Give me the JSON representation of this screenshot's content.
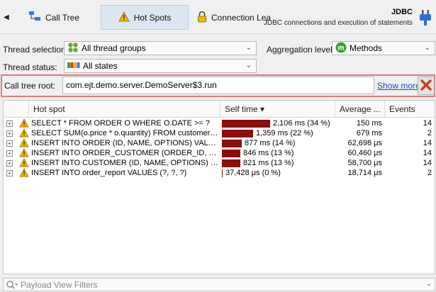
{
  "tabs": {
    "call_tree": "Call Tree",
    "hot_spots": "Hot Spots",
    "connection": "Connection Lea"
  },
  "header": {
    "title": "JDBC",
    "subtitle": "JDBC connections and execution of statements"
  },
  "form": {
    "thread_selection_label": "Thread selection:",
    "thread_selection_value": "All thread groups",
    "aggregation_label": "Aggregation level:",
    "aggregation_value": "Methods",
    "thread_status_label": "Thread status:",
    "thread_status_value": "All states",
    "call_tree_root_label": "Call tree root:",
    "call_tree_root_value": "com.ejt.demo.server.DemoServer$3.run",
    "show_more": "Show more"
  },
  "table": {
    "columns": [
      "Hot spot",
      "Self time ▾",
      "Average ...",
      "Events"
    ],
    "rows": [
      {
        "hotspot": "SELECT * FROM ORDER O WHERE O.DATE >= ?",
        "self": "2,106 ms (34 %)",
        "fraction": 0.34,
        "avg": "150 ms",
        "events": "14"
      },
      {
        "hotspot": "SELECT SUM(o.price * o.quantity) FROM customers ...",
        "self": "1,359 ms (22 %)",
        "fraction": 0.22,
        "avg": "679 ms",
        "events": "2"
      },
      {
        "hotspot": "INSERT INTO ORDER (ID, NAME, OPTIONS) VALUES...",
        "self": "877 ms (14 %)",
        "fraction": 0.14,
        "avg": "62,698 μs",
        "events": "14"
      },
      {
        "hotspot": "INSERT INTO ORDER_CUSTOMER (ORDER_ID, CUS...",
        "self": "846 ms (13 %)",
        "fraction": 0.13,
        "avg": "60,460 μs",
        "events": "14"
      },
      {
        "hotspot": "INSERT INTO CUSTOMER (ID, NAME, OPTIONS) VA...",
        "self": "821 ms (13 %)",
        "fraction": 0.13,
        "avg": "58,700 μs",
        "events": "14"
      },
      {
        "hotspot": "INSERT INTO order_report VALUES (?, ?, ?)",
        "self": "37,428 μs (0 %)",
        "fraction": 0.0,
        "avg": "18,714 μs",
        "events": "2"
      }
    ]
  },
  "filter": {
    "placeholder": "Payload View Filters"
  },
  "colors": {
    "bar": "#8b0d0d",
    "selected_tab": "#dbe6f2",
    "highlight_frame": "#e07a7a",
    "close_icon": "#c8401e",
    "warning_icon": "#f2b705",
    "link": "#1a4fa8"
  },
  "icons": {
    "back": "triangle-left-icon",
    "call_tree": "call-tree-icon",
    "hot_spots": "warning-icon",
    "connection": "lock-icon",
    "jdbc": "plug-icon",
    "thread_groups": "thread-groups-icon",
    "aggregation": "methods-m-icon",
    "thread_status": "states-icon",
    "close": "close-x-icon",
    "filter": "filter-funnel-icon"
  }
}
